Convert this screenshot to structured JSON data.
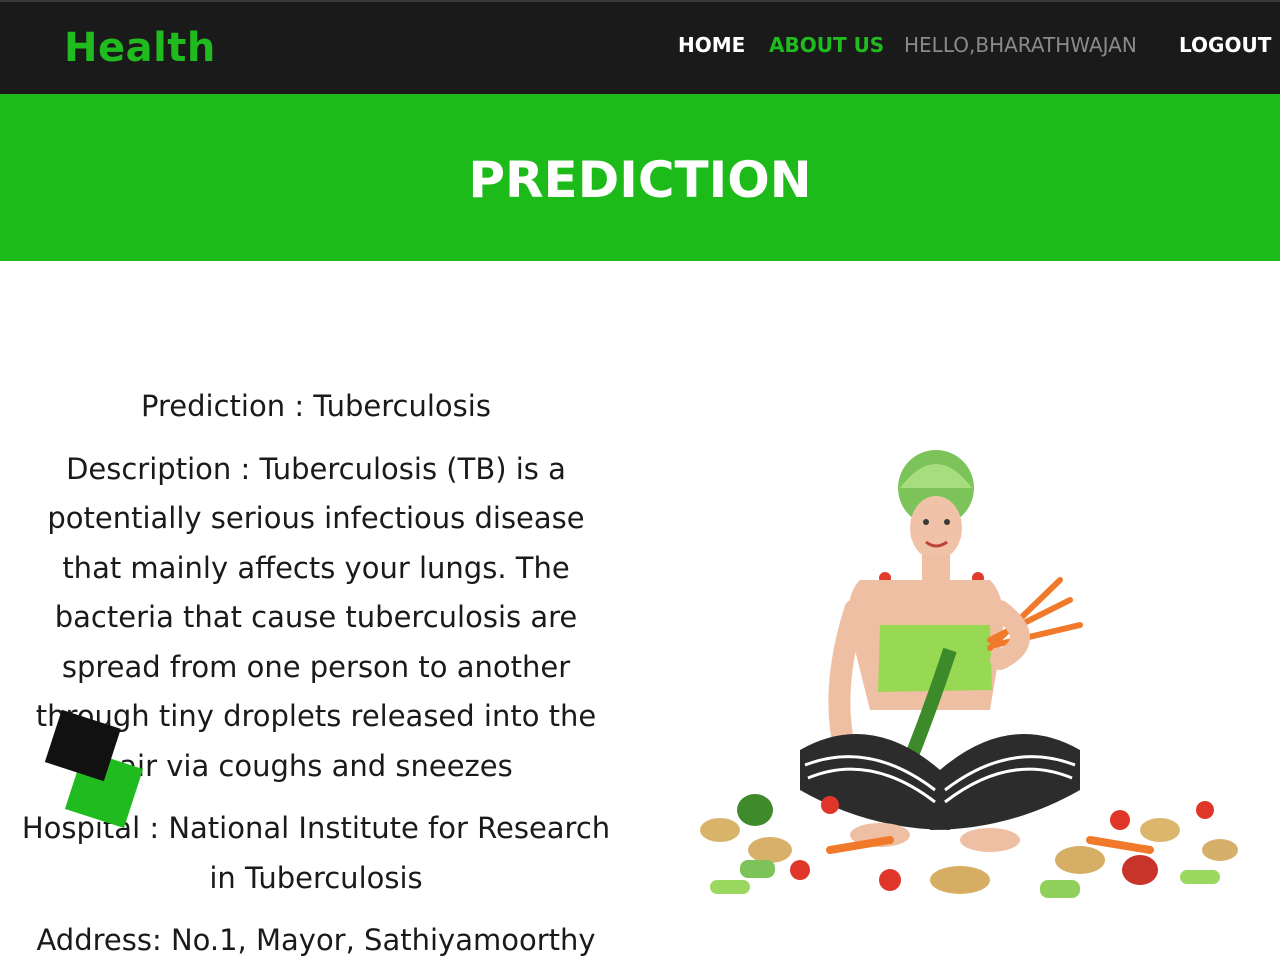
{
  "header": {
    "brand": "Health",
    "nav": {
      "home": "HOME",
      "about": "ABOUT US",
      "greeting": "HELLO,BHARATHWAJAN",
      "logout": "LOGOUT"
    }
  },
  "banner": {
    "title": "PREDICTION"
  },
  "result": {
    "prediction_label": "Prediction :",
    "prediction_value": "Tuberculosis",
    "description_label": "Description :",
    "description_value": "Tuberculosis (TB) is a potentially serious infectious disease that mainly affects your lungs. The bacteria that cause tuberculosis are spread from one person to another through tiny droplets released into the air via coughs and sneezes",
    "hospital_label": "Hospital :",
    "hospital_value": "National Institute for Research in Tuberculosis",
    "address_label": "Address:",
    "address_value": "No.1, Mayor, Sathiyamoorthy"
  },
  "colors": {
    "accent": "#1dbb1a",
    "topbar": "#1a1a1a"
  }
}
